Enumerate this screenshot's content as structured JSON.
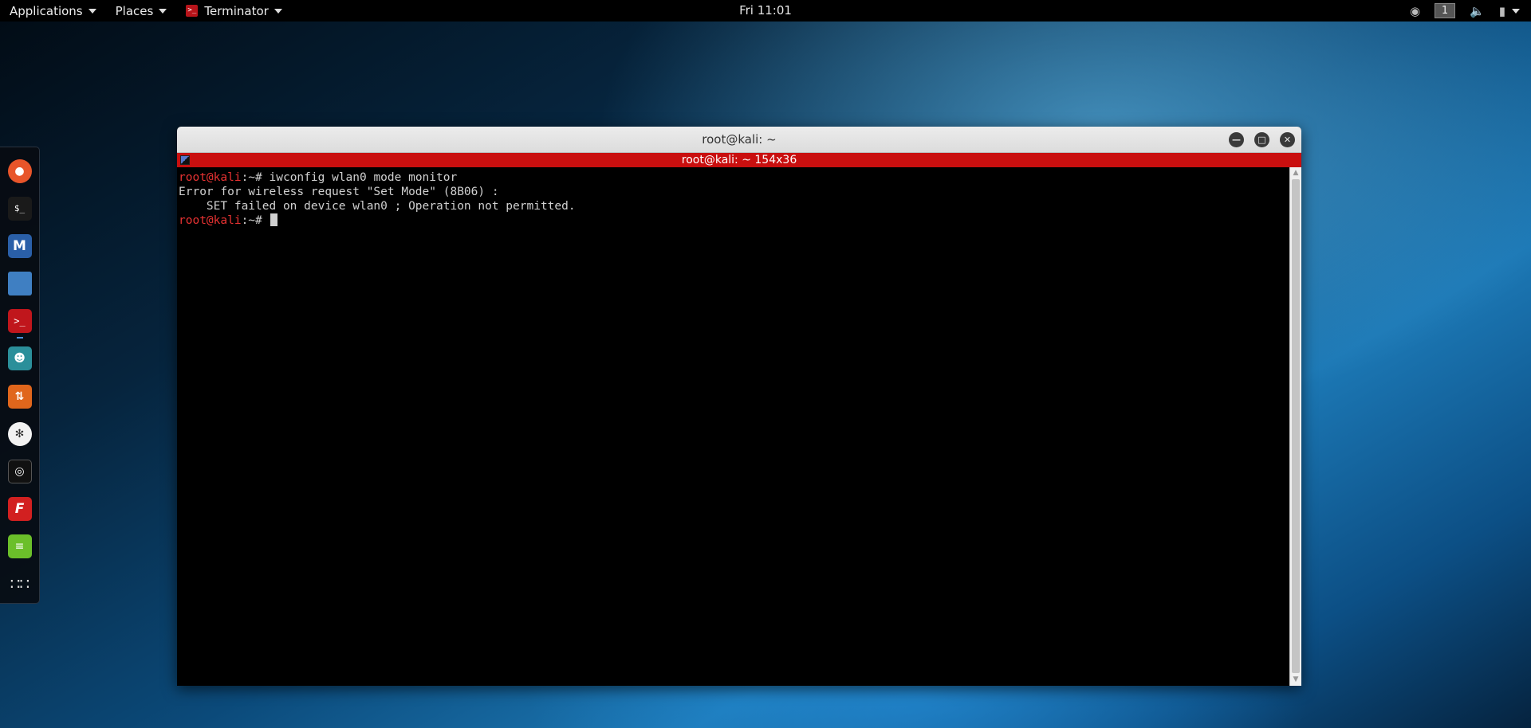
{
  "topbar": {
    "applications_label": "Applications",
    "places_label": "Places",
    "terminator_label": "Terminator",
    "clock": "Fri 11:01",
    "workspace": "1"
  },
  "dock": {
    "items": [
      {
        "icon": "firefox-icon",
        "color": "#e8552a"
      },
      {
        "icon": "terminal-icon",
        "color": "#1a1a1a"
      },
      {
        "icon": "metasploit-icon",
        "color": "#2a5fa8"
      },
      {
        "icon": "files-icon",
        "color": "#3f7fc2"
      },
      {
        "icon": "terminator-icon",
        "color": "#c0161c"
      },
      {
        "icon": "armitage-icon",
        "color": "#2b8f9a"
      },
      {
        "icon": "burpsuite-icon",
        "color": "#e0661c"
      },
      {
        "icon": "maltego-icon",
        "color": "#2b2b2b"
      },
      {
        "icon": "cutycapt-icon",
        "color": "#111111"
      },
      {
        "icon": "faraday-icon",
        "color": "#d22020"
      },
      {
        "icon": "text-editor-icon",
        "color": "#6bbf2a"
      },
      {
        "icon": "show-apps-icon",
        "color": "transparent"
      }
    ]
  },
  "window": {
    "title": "root@kali: ~",
    "terminal_title": "root@kali: ~ 154x36"
  },
  "terminal": {
    "prompt_user": "root@kali",
    "prompt_path": ":~# ",
    "command": "iwconfig wlan0 mode monitor",
    "error_line_1": "Error for wireless request \"Set Mode\" (8B06) :",
    "error_line_2": "    SET failed on device wlan0 ; Operation not permitted.",
    "prompt_user_2": "root@kali",
    "prompt_path_2": ":~# "
  }
}
